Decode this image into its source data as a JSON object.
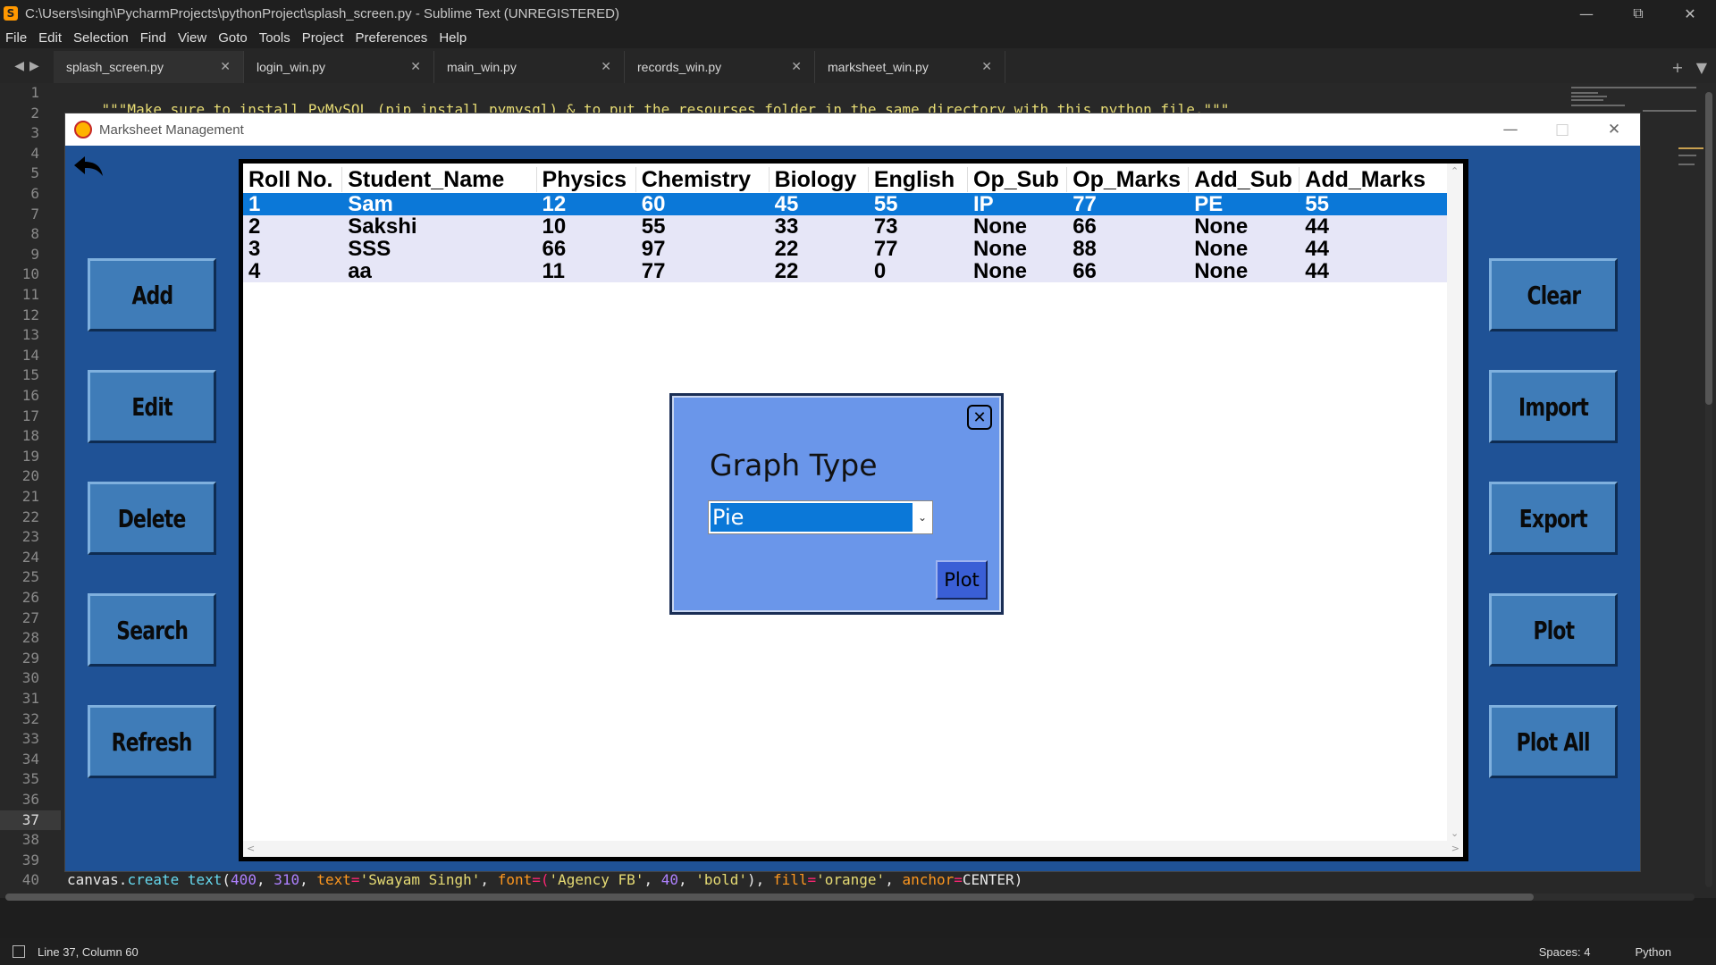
{
  "sublime": {
    "title": "C:\\Users\\singh\\PycharmProjects\\pythonProject\\splash_screen.py - Sublime Text (UNREGISTERED)",
    "menu": [
      "File",
      "Edit",
      "Selection",
      "Find",
      "View",
      "Goto",
      "Tools",
      "Project",
      "Preferences",
      "Help"
    ],
    "tabs": [
      {
        "label": "splash_screen.py",
        "active": true
      },
      {
        "label": "login_win.py",
        "active": false
      },
      {
        "label": "main_win.py",
        "active": false
      },
      {
        "label": "records_win.py",
        "active": false
      },
      {
        "label": "marksheet_win.py",
        "active": false
      }
    ],
    "line_numbers": [
      "1",
      "2",
      "3",
      "4",
      "5",
      "6",
      "7",
      "8",
      "9",
      "10",
      "11",
      "12",
      "13",
      "14",
      "15",
      "16",
      "17",
      "18",
      "19",
      "20",
      "21",
      "22",
      "23",
      "24",
      "25",
      "26",
      "27",
      "28",
      "29",
      "30",
      "31",
      "32",
      "33",
      "34",
      "35",
      "36",
      "37",
      "38",
      "39",
      "40"
    ],
    "current_line": "37",
    "code_line_1": "\"\"\"Make sure to install PyMySQL (pip install pymysql) & to put the resourses folder in the same directory with this python file.\"\"\"",
    "code_line_40": {
      "p1": "canvas.",
      "p2": "create text",
      "p3": "(",
      "p4": "400",
      "p5": ", ",
      "p6": "310",
      "p7": ", ",
      "p8": "text",
      "p9": "=",
      "p10": "'Swayam Singh'",
      "p11": ", ",
      "p12": "font",
      "p13": "=(",
      "p14": "'Agency FB'",
      "p15": ", ",
      "p16": "40",
      "p17": ", ",
      "p18": "'bold'",
      "p19": "), ",
      "p20": "fill",
      "p21": "=",
      "p22": "'orange'",
      "p23": ", ",
      "p24": "anchor",
      "p25": "=",
      "p26": "CENTER",
      "p27": ")"
    },
    "status": {
      "position": "Line 37, Column 60",
      "spaces": "Spaces: 4",
      "syntax": "Python"
    }
  },
  "tk": {
    "title": "Marksheet Management",
    "left_buttons": [
      "Add",
      "Edit",
      "Delete",
      "Search",
      "Refresh"
    ],
    "right_buttons": [
      "Clear",
      "Import",
      "Export",
      "Plot",
      "Plot All"
    ],
    "table": {
      "columns": [
        "Roll No.",
        "Student_Name",
        "Physics",
        "Chemistry",
        "Biology",
        "English",
        "Op_Sub",
        "Op_Marks",
        "Add_Sub",
        "Add_Marks"
      ],
      "rows": [
        [
          "1",
          "Sam",
          "12",
          "60",
          "45",
          "55",
          "IP",
          "77",
          "PE",
          "55"
        ],
        [
          "2",
          "Sakshi",
          "10",
          "55",
          "33",
          "73",
          "None",
          "66",
          "None",
          "44"
        ],
        [
          "3",
          "SSS",
          "66",
          "97",
          "22",
          "77",
          "None",
          "88",
          "None",
          "44"
        ],
        [
          "4",
          "aa",
          "11",
          "77",
          "22",
          "0",
          "None",
          "66",
          "None",
          "44"
        ]
      ],
      "selected_row": 0
    },
    "dialog": {
      "label": "Graph Type",
      "selected": "Pie",
      "plot_button": "Plot"
    }
  }
}
